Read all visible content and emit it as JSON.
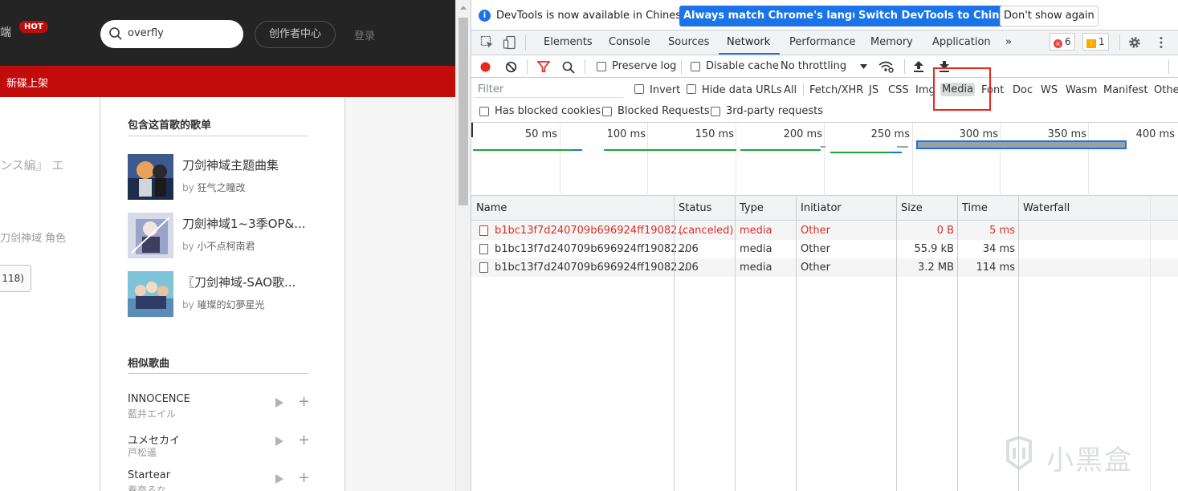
{
  "webpage": {
    "client_fragment": "端",
    "hot_badge": "HOT",
    "search_value": "overfly",
    "creator_center": "创作者中心",
    "login": "登录",
    "redbar_label": "新碟上架",
    "frag_1": "ンス編』 エ",
    "frag_2": "刀剑神域 角色",
    "frag_btn": "118)",
    "playlists_title": "包含这首歌的歌单",
    "playlists": [
      {
        "title": "刀剑神域主题曲集",
        "by_prefix": "by",
        "author": "狂气之瞳改"
      },
      {
        "title": "刀劍神域1~3季OP&...",
        "by_prefix": "by",
        "author": "小不点柯南君"
      },
      {
        "title": "〖刀剑神域-SAO歌...",
        "by_prefix": "by",
        "author": "璀璨的幻夢星光"
      }
    ],
    "similar_title": "相似歌曲",
    "songs": [
      {
        "title": "INNOCENCE",
        "artist": "藍井エイル"
      },
      {
        "title": "ユメセカイ",
        "artist": "戸松遥"
      },
      {
        "title": "Startear",
        "artist": "春奈るな"
      }
    ],
    "plus": "+"
  },
  "devtools": {
    "info": {
      "icon": "i",
      "text": "DevTools is now available in Chinese!",
      "btn_match": "Always match Chrome's language",
      "btn_switch": "Switch DevTools to Chinese",
      "btn_dismiss": "Don't show again"
    },
    "tabs": [
      "Elements",
      "Console",
      "Sources",
      "Network",
      "Performance",
      "Memory",
      "Application"
    ],
    "more_tabs": "»",
    "errors_count": "6",
    "error_glyph": "×",
    "warnings_count": "1",
    "warning_glyph": "!",
    "network_toolbar": {
      "preserve_log": "Preserve log",
      "disable_cache": "Disable cache",
      "throttling": "No throttling"
    },
    "filter": {
      "placeholder": "Filter",
      "invert": "Invert",
      "hide_data_urls": "Hide data URLs",
      "types": [
        "All",
        "Fetch/XHR",
        "JS",
        "CSS",
        "Img",
        "Media",
        "Font",
        "Doc",
        "WS",
        "Wasm",
        "Manifest",
        "Other"
      ],
      "selected": "Media"
    },
    "blocked": {
      "has_blocked_cookies": "Has blocked cookies",
      "blocked_requests": "Blocked Requests",
      "third_party": "3rd-party requests"
    },
    "overview_ticks": [
      "50 ms",
      "100 ms",
      "150 ms",
      "200 ms",
      "250 ms",
      "300 ms",
      "350 ms",
      "400 ms"
    ],
    "columns": [
      "Name",
      "Status",
      "Type",
      "Initiator",
      "Size",
      "Time",
      "Waterfall"
    ],
    "rows": [
      {
        "name": "b1bc13f7d240709b696924ff19082...",
        "status": "(canceled)",
        "type": "media",
        "initiator": "Other",
        "size": "0 B",
        "time": "5 ms",
        "error": true
      },
      {
        "name": "b1bc13f7d240709b696924ff19082...",
        "status": "206",
        "type": "media",
        "initiator": "Other",
        "size": "55.9 kB",
        "time": "34 ms",
        "error": false
      },
      {
        "name": "b1bc13f7d240709b696924ff19082...",
        "status": "206",
        "type": "media",
        "initiator": "Other",
        "size": "3.2 MB",
        "time": "114 ms",
        "error": false
      }
    ]
  },
  "watermark_text": "小黑盒",
  "colors": {
    "accent": "#1a73e8",
    "brand_red": "#c20c0c",
    "error": "#d93025",
    "highlight": "#e8271f"
  }
}
